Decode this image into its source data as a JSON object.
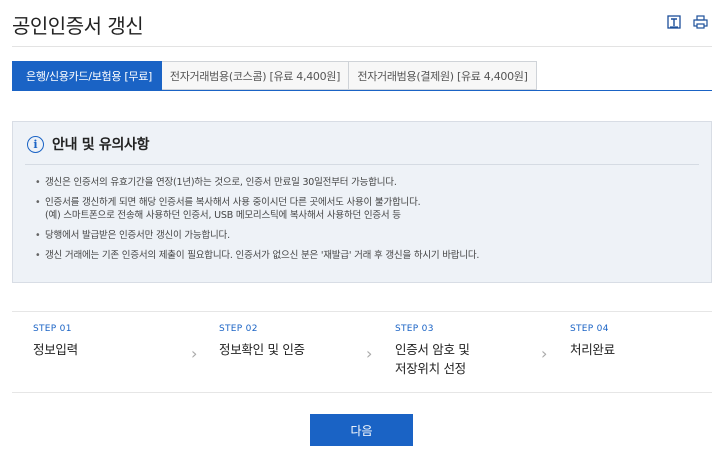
{
  "page": {
    "title": "공인인증서 갱신"
  },
  "toolbar": {
    "icons": [
      "save-text-icon",
      "print-icon"
    ]
  },
  "tabs": [
    {
      "label": "은행/신용카드/보험용 [무료]",
      "active": true
    },
    {
      "label": "전자거래범용(코스콤) [유료 4,400원]",
      "active": false
    },
    {
      "label": "전자거래범용(결제원) [유료 4,400원]",
      "active": false
    }
  ],
  "notice": {
    "title": "안내 및 유의사항",
    "items": [
      {
        "line1": "갱신은 인증서의 유효기간을 연장(1년)하는 것으로, 인증서 만료일 30일전부터 가능합니다."
      },
      {
        "line1": "인증서를 갱신하게 되면 해당 인증서를 복사해서 사용 중이시던 다른 곳에서도 사용이 불가합니다.",
        "line2": "(예) 스마트폰으로 전송해 사용하던 인증서, USB 메모리스틱에 복사해서 사용하던 인증서 등"
      },
      {
        "line1": "당행에서 발급받은 인증서만 갱신이 가능합니다."
      },
      {
        "line1": "갱신 거래에는 기존 인증서의 제출이 필요합니다. 인증서가 없으신 분은 '재발급' 거래 후 갱신을 하시기 바랍니다."
      }
    ]
  },
  "steps": [
    {
      "num": "STEP 01",
      "label": "정보입력"
    },
    {
      "num": "STEP 02",
      "label": "정보확인 및 인증"
    },
    {
      "num": "STEP 03",
      "label_line1": "인증서 암호 및",
      "label_line2": "저장위치 선정"
    },
    {
      "num": "STEP 04",
      "label": "처리완료"
    }
  ],
  "actions": {
    "next_label": "다음"
  },
  "colors": {
    "accent": "#1a63c5",
    "notice_bg": "#eef2f7"
  }
}
